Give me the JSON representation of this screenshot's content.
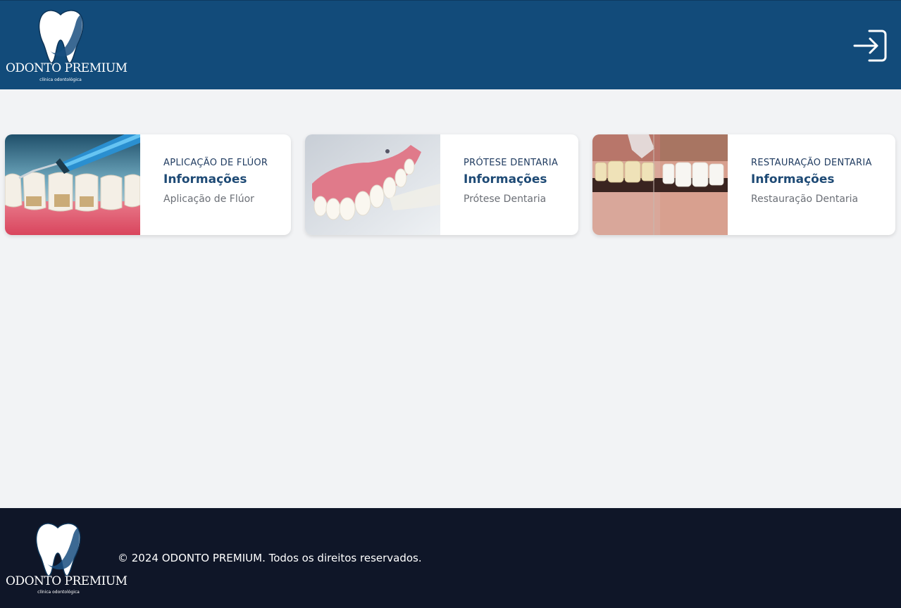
{
  "header": {
    "logo": {
      "brand": "ODONTO PREMIUM",
      "tagline": "clínica odontológica"
    },
    "login_icon": "login-icon"
  },
  "cards": [
    {
      "category": "APLICAÇÃO DE FLÚOR",
      "title": "Informações",
      "description": "Aplicação de Flúor",
      "image": "fluoride-application-image"
    },
    {
      "category": "PRÓTESE DENTARIA",
      "title": "Informações",
      "description": "Prótese Dentaria",
      "image": "dental-prosthesis-image"
    },
    {
      "category": "RESTAURAÇÃO DENTARIA",
      "title": "Informações",
      "description": "Restauração Dentaria",
      "image": "dental-restoration-image"
    }
  ],
  "footer": {
    "logo": {
      "brand": "ODONTO PREMIUM",
      "tagline": "clínica odontológica"
    },
    "copyright": "© 2024 ODONTO PREMIUM. Todos os direitos reservados."
  },
  "colors": {
    "header_bg": "#124b7a",
    "footer_bg": "#0f1628",
    "page_bg": "#f2f3f5",
    "accent": "#1e4a75"
  }
}
